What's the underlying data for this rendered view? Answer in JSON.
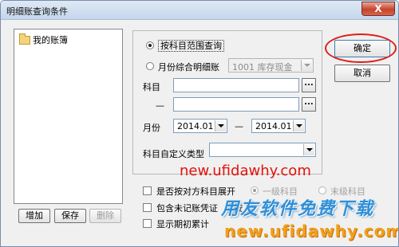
{
  "window": {
    "title": "明细账查询条件",
    "close_glyph": "X"
  },
  "tree": {
    "items": [
      {
        "label": "我的账簿"
      }
    ]
  },
  "tree_buttons": {
    "add": "增加",
    "save": "保存",
    "delete": "删除"
  },
  "options": {
    "radio_range": "按科目范围查询",
    "radio_monthly": "月份综合明细账",
    "monthly_account_select": "1001 库存现金",
    "subject_label": "科目",
    "subject_from": "",
    "subject_dash": "—",
    "subject_to": "",
    "ellipsis": "...",
    "month_label": "月份",
    "month_from": "2014.01",
    "month_dash": "—",
    "month_to": "2014.01",
    "custom_type_label": "科目自定义类型",
    "custom_type_value": ""
  },
  "checkboxes": {
    "expand_counter": "是否按对方科目展开",
    "include_unposted": "包含未记账凭证",
    "show_opening": "显示期初累计",
    "partial_hidden": "按"
  },
  "level_radios": {
    "first_level": "一级科目",
    "last_level": "末级科目"
  },
  "buttons": {
    "ok": "确定",
    "cancel": "取消"
  },
  "watermarks": {
    "url_red": "new.ufidawhy.com",
    "slogan": "用友软件免费下载",
    "url_orange": "new.ufidawhy.com"
  },
  "colors": {
    "accent_red": "#e0201a",
    "watermark_blue": "#2f8fd8",
    "watermark_orange": "#f0a020"
  }
}
